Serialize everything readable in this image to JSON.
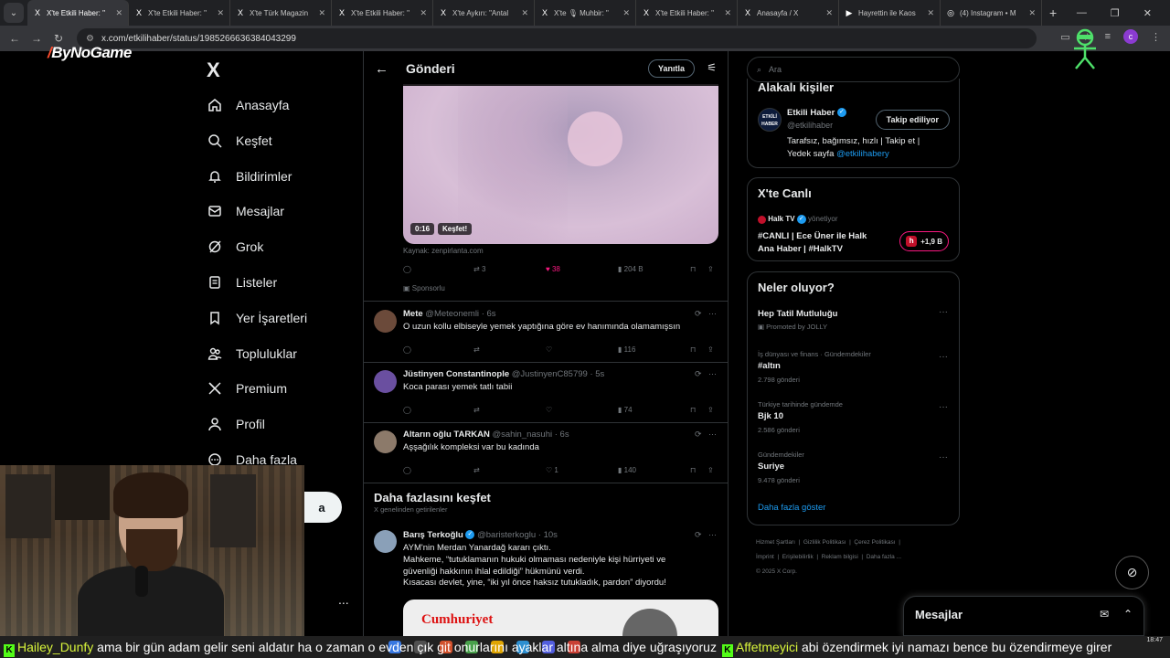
{
  "browser": {
    "tabs": [
      {
        "title": "X'te Etkili Haber: \"",
        "active": true,
        "favicon": "X"
      },
      {
        "title": "X'te Etkili Haber: \"",
        "active": false,
        "favicon": "X"
      },
      {
        "title": "X'te Türk Magazin",
        "active": false,
        "favicon": "X"
      },
      {
        "title": "X'te Etkili Haber: \"",
        "active": false,
        "favicon": "X"
      },
      {
        "title": "X'te Aykırı: \"Antal",
        "active": false,
        "favicon": "X"
      },
      {
        "title": "X'te 🎙 Muhbir: \"",
        "active": false,
        "favicon": "X"
      },
      {
        "title": "X'te Etkili Haber: \"",
        "active": false,
        "favicon": "X"
      },
      {
        "title": "Anasayfa / X",
        "active": false,
        "favicon": "X"
      },
      {
        "title": "Hayrettin ile Kaos",
        "active": false,
        "favicon": "▶"
      },
      {
        "title": "(4) Instagram • M",
        "active": false,
        "favicon": "◎"
      }
    ],
    "new_tab": "+",
    "url": "x.com/etkilihaber/status/1985266636384043299",
    "profile_initial": "c"
  },
  "watermark": {
    "text": "ByNoGame",
    "slash": "/"
  },
  "nav": {
    "logo": "X",
    "items": [
      {
        "label": "Anasayfa",
        "icon": "home-icon"
      },
      {
        "label": "Keşfet",
        "icon": "search-icon"
      },
      {
        "label": "Bildirimler",
        "icon": "bell-icon"
      },
      {
        "label": "Mesajlar",
        "icon": "mail-icon"
      },
      {
        "label": "Grok",
        "icon": "grok-icon"
      },
      {
        "label": "Listeler",
        "icon": "list-icon"
      },
      {
        "label": "Yer İşaretleri",
        "icon": "bookmark-icon"
      },
      {
        "label": "Topluluklar",
        "icon": "people-icon"
      },
      {
        "label": "Premium",
        "icon": "x-icon"
      },
      {
        "label": "Profil",
        "icon": "user-icon"
      },
      {
        "label": "Daha fazla",
        "icon": "more-icon"
      }
    ],
    "post_label": "a",
    "more": "..."
  },
  "center": {
    "header_title": "Gönderi",
    "reply_label": "Yanıtla",
    "video": {
      "time": "0:16",
      "explore": "Keşfet!"
    },
    "source": "Kaynak: zenpirlanta.com",
    "ad_stats": {
      "retweets": "3",
      "likes": "38",
      "views": "204 B"
    },
    "sponsored": "Sponsorlu",
    "replies": [
      {
        "name": "Mete",
        "handle": "@Meteonemli",
        "time": "· 6s",
        "text": "O uzun kollu elbiseyle yemek yaptığına göre ev hanımında olamamışsın",
        "likes": "",
        "views": "116",
        "avatar_color": "#6b4a3a"
      },
      {
        "name": "Jüstinyen Constantinople",
        "handle": "@JustinyenC85799",
        "time": "· 5s",
        "text": "Koca parası yemek tatlı tabii",
        "likes": "",
        "views": "74",
        "avatar_color": "#6a4fa0"
      },
      {
        "name": "Altarın oğlu TARKAN",
        "handle": "@sahin_nasuhi",
        "time": "· 6s",
        "text": "Aşşağılık kompleksi var bu kadında",
        "likes": "1",
        "views": "140",
        "avatar_color": "#8c7a6a"
      }
    ],
    "discover_title": "Daha fazlasını keşfet",
    "discover_sub": "X genelinden getirilenler",
    "featured": {
      "name": "Barış Terkoğlu",
      "handle": "@baristerkoglu",
      "time": "· 10s",
      "lines": [
        "AYM'nin Merdan Yanardağ kararı çıktı.",
        "Mahkeme, “tutuklamanın hukuki olmaması nedeniyle kişi hürriyeti ve",
        "güvenliği hakkının ihlal edildiği” hükmünü verdi.",
        "Kısacası devlet, yine, “iki yıl önce haksız tutukladık, pardon” diyordu!"
      ],
      "media_logo": "Cumhuriyet"
    }
  },
  "right": {
    "search_placeholder": "Ara",
    "related_title": "Alakalı kişiler",
    "account": {
      "name": "Etkili Haber",
      "handle": "@etkilihaber",
      "follow": "Takip ediliyor",
      "bio1": "Tarafsız, bağımsız, hızlı | Takip et |",
      "bio2_prefix": "Yedek sayfa ",
      "bio2_link": "@etkilihabery"
    },
    "live_title": "X'te Canlı",
    "live": {
      "channel": "Halk TV",
      "role": "yönetiyor",
      "line1": "#CANLI | Ece Üner ile Halk",
      "line2": "Ana Haber | #HalkTV",
      "count": "+1,9 B"
    },
    "trends_title": "Neler oluyor?",
    "trends": [
      {
        "category": "",
        "name": "Hep Tatil Mutluluğu",
        "count": "Promoted by JOLLY"
      },
      {
        "category": "İş dünyası ve finans · Gündemdekiler",
        "name": "#altın",
        "count": "2.798 gönderi"
      },
      {
        "category": "Türkiye tarihinde gündemde",
        "name": "Bjk 10",
        "count": "2.586 gönderi"
      },
      {
        "category": "Gündemdekiler",
        "name": "Suriye",
        "count": "9.478 gönderi"
      }
    ],
    "show_more": "Daha fazla göster",
    "footer": [
      "Hizmet Şartları",
      "Gizlilik Politikası",
      "Çerez Politikası",
      "İmprint",
      "Erişilebilirlik",
      "Reklam bilgisi",
      "Daha fazla ...",
      "© 2025 X Corp."
    ]
  },
  "messages_drawer": {
    "title": "Mesajlar"
  },
  "chat": {
    "user1": "Hailey_Dunfy",
    "msg1": " ama bir gün adam gelir seni aldatır ha o zaman o evden çık git onurlarını ayaklar altına alma diye uğraşıyoruz ",
    "user2": "Affetmeyici",
    "msg2": " abi özendirmek iyi namazı bence bu özendirmeye girer"
  },
  "clock": {
    "time": "18:47"
  }
}
